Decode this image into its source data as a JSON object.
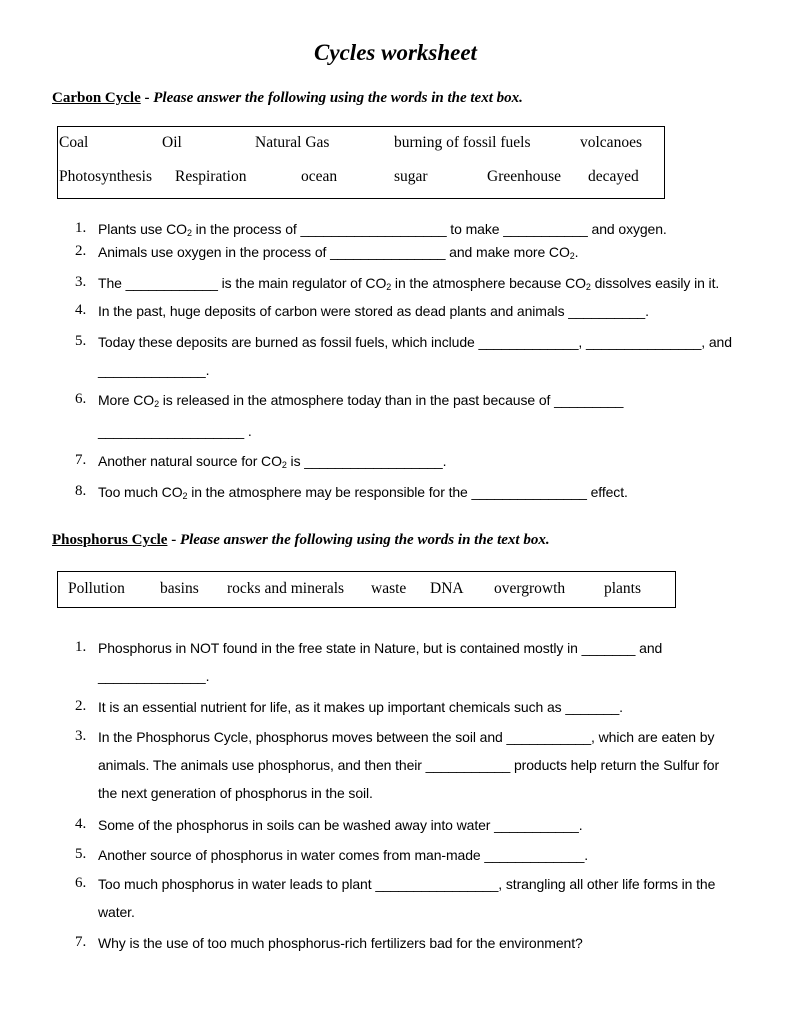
{
  "title": "Cycles worksheet",
  "carbon": {
    "heading": "Carbon Cycle",
    "separator": " - ",
    "instruction": "Please answer the following using the words in the text box.",
    "word_bank": {
      "row1": [
        "Coal",
        "Oil",
        "Natural Gas",
        "burning of fossil fuels",
        "volcanoes"
      ],
      "row2": [
        "Photosynthesis",
        "Respiration",
        "ocean",
        "sugar",
        "Greenhouse",
        "decayed"
      ]
    },
    "questions": [
      {
        "num": "1.",
        "a": "Plants use CO",
        "sub": "2",
        "b": " in the process of ___________________ to make ___________ and oxygen."
      },
      {
        "num": "2.",
        "a": "Animals use oxygen in the process of _______________ and make more CO",
        "sub": "2",
        "b": "."
      },
      {
        "num": "3.",
        "a": "The ____________ is the main regulator of CO",
        "sub": "2",
        "b": " in the atmosphere because CO",
        "sub2": "2",
        "c": " dissolves easily in it."
      },
      {
        "num": "4.",
        "a": "In the past, huge deposits of carbon were stored as dead plants and animals __________."
      },
      {
        "num": "5.",
        "a": "Today these deposits are burned as fossil fuels, which include _____________, _______________, and",
        "cont": "______________."
      },
      {
        "num": "6.",
        "a": "More CO",
        "sub": "2",
        "b": " is released in the atmosphere today than in the past because of _________",
        "cont": "___________________ ."
      },
      {
        "num": "7.",
        "a": "Another natural source for CO",
        "sub": "2",
        "b": " is __________________."
      },
      {
        "num": "8.",
        "a": "Too much CO",
        "sub": "2",
        "b": " in the atmosphere may be responsible for the _______________ effect."
      }
    ]
  },
  "phosphorus": {
    "heading": "Phosphorus Cycle",
    "separator": " - ",
    "instruction": "Please answer the following using the words in the text box.",
    "word_bank": [
      "Pollution",
      "basins",
      "rocks and minerals",
      "waste",
      "DNA",
      "overgrowth",
      "plants"
    ],
    "questions": [
      {
        "num": "1.",
        "a": "Phosphorus in NOT found in the free state in Nature, but is contained mostly in _______ and",
        "cont": "______________."
      },
      {
        "num": "2.",
        "a": "It is an essential nutrient for life, as it makes up important chemicals such as _______."
      },
      {
        "num": "3.",
        "a": "In the Phosphorus Cycle, phosphorus moves between the soil and ___________, which are eaten by",
        "cont": "animals.  The animals use phosphorus, and then their ___________ products help return the Sulfur for",
        "cont2": "the next generation of phosphorus in the soil."
      },
      {
        "num": "4.",
        "a": "Some of the phosphorus in soils can be washed away into water ___________."
      },
      {
        "num": "5.",
        "a": "Another source of phosphorus in water comes from man-made _____________."
      },
      {
        "num": "6.",
        "a": "Too much phosphorus in water leads to plant ________________, strangling all other life forms in the",
        "cont": "water."
      },
      {
        "num": "7.",
        "a": "Why is the use of too much phosphorus-rich fertilizers bad for the environment?"
      }
    ]
  }
}
